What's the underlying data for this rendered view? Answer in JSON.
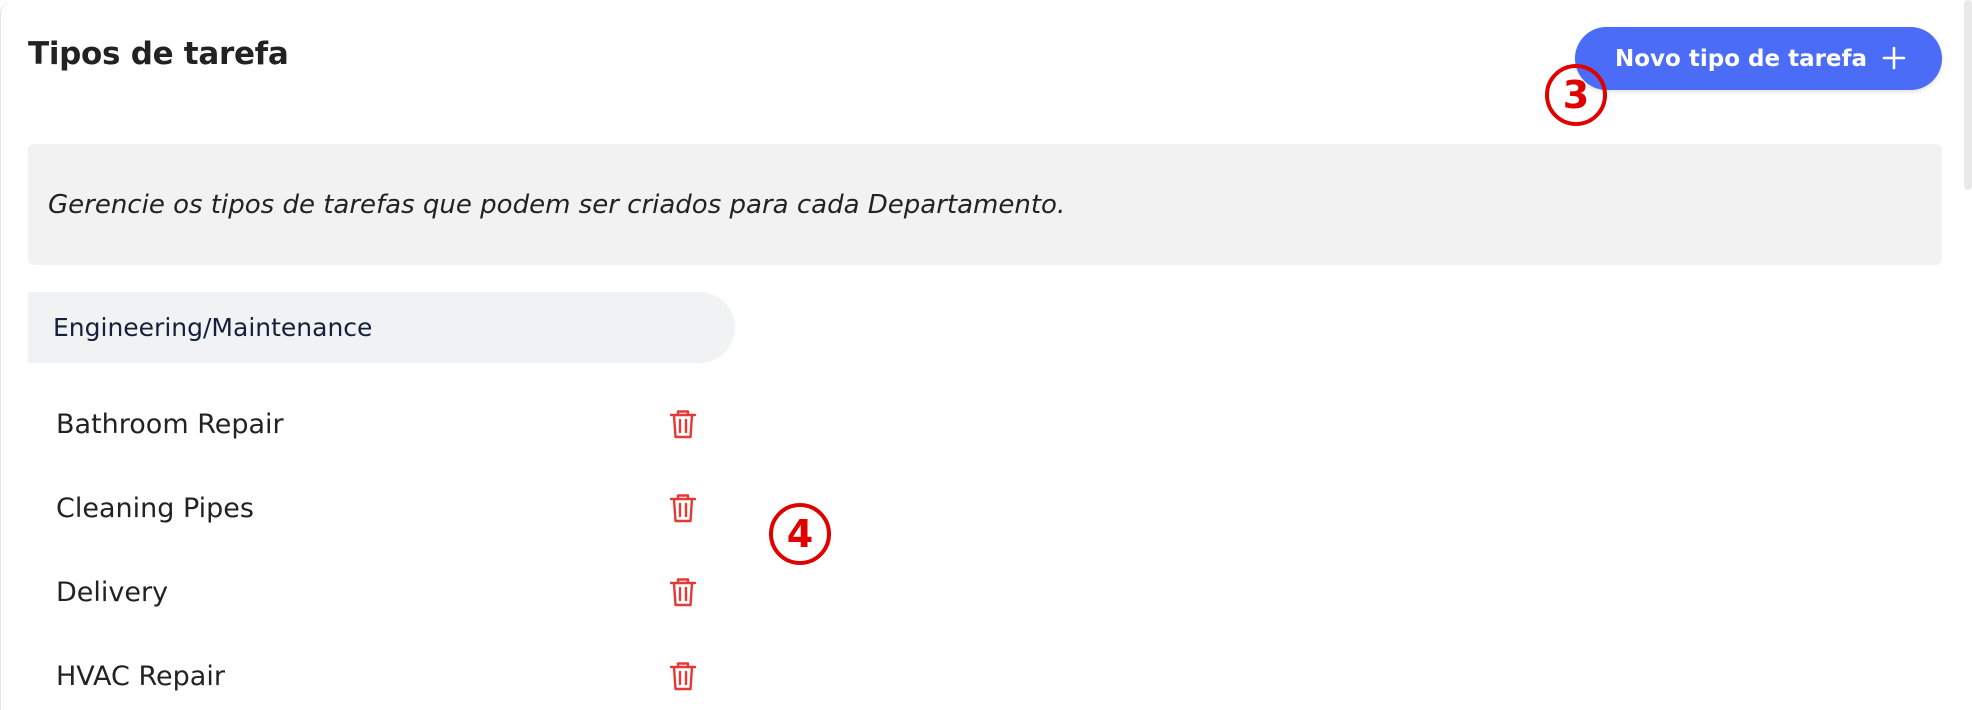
{
  "header": {
    "title": "Tipos de tarefa",
    "new_button_label": "Novo tipo de tarefa",
    "new_button_icon": "plus-icon"
  },
  "info": {
    "text": "Gerencie os tipos de tarefas que podem ser criados para cada Departamento."
  },
  "department": {
    "name": "Engineering/Maintenance",
    "tasks": [
      {
        "label": "Bathroom Repair",
        "action_icon": "trash-icon"
      },
      {
        "label": "Cleaning Pipes",
        "action_icon": "trash-icon"
      },
      {
        "label": "Delivery",
        "action_icon": "trash-icon"
      },
      {
        "label": "HVAC Repair",
        "action_icon": "trash-icon"
      }
    ]
  },
  "callouts": [
    "3",
    "4"
  ],
  "colors": {
    "accent": "#4a6cf7",
    "danger": "#e53935",
    "callout": "#e00000",
    "info_bg": "#f2f2f2",
    "dept_bg": "#f1f2f4"
  }
}
